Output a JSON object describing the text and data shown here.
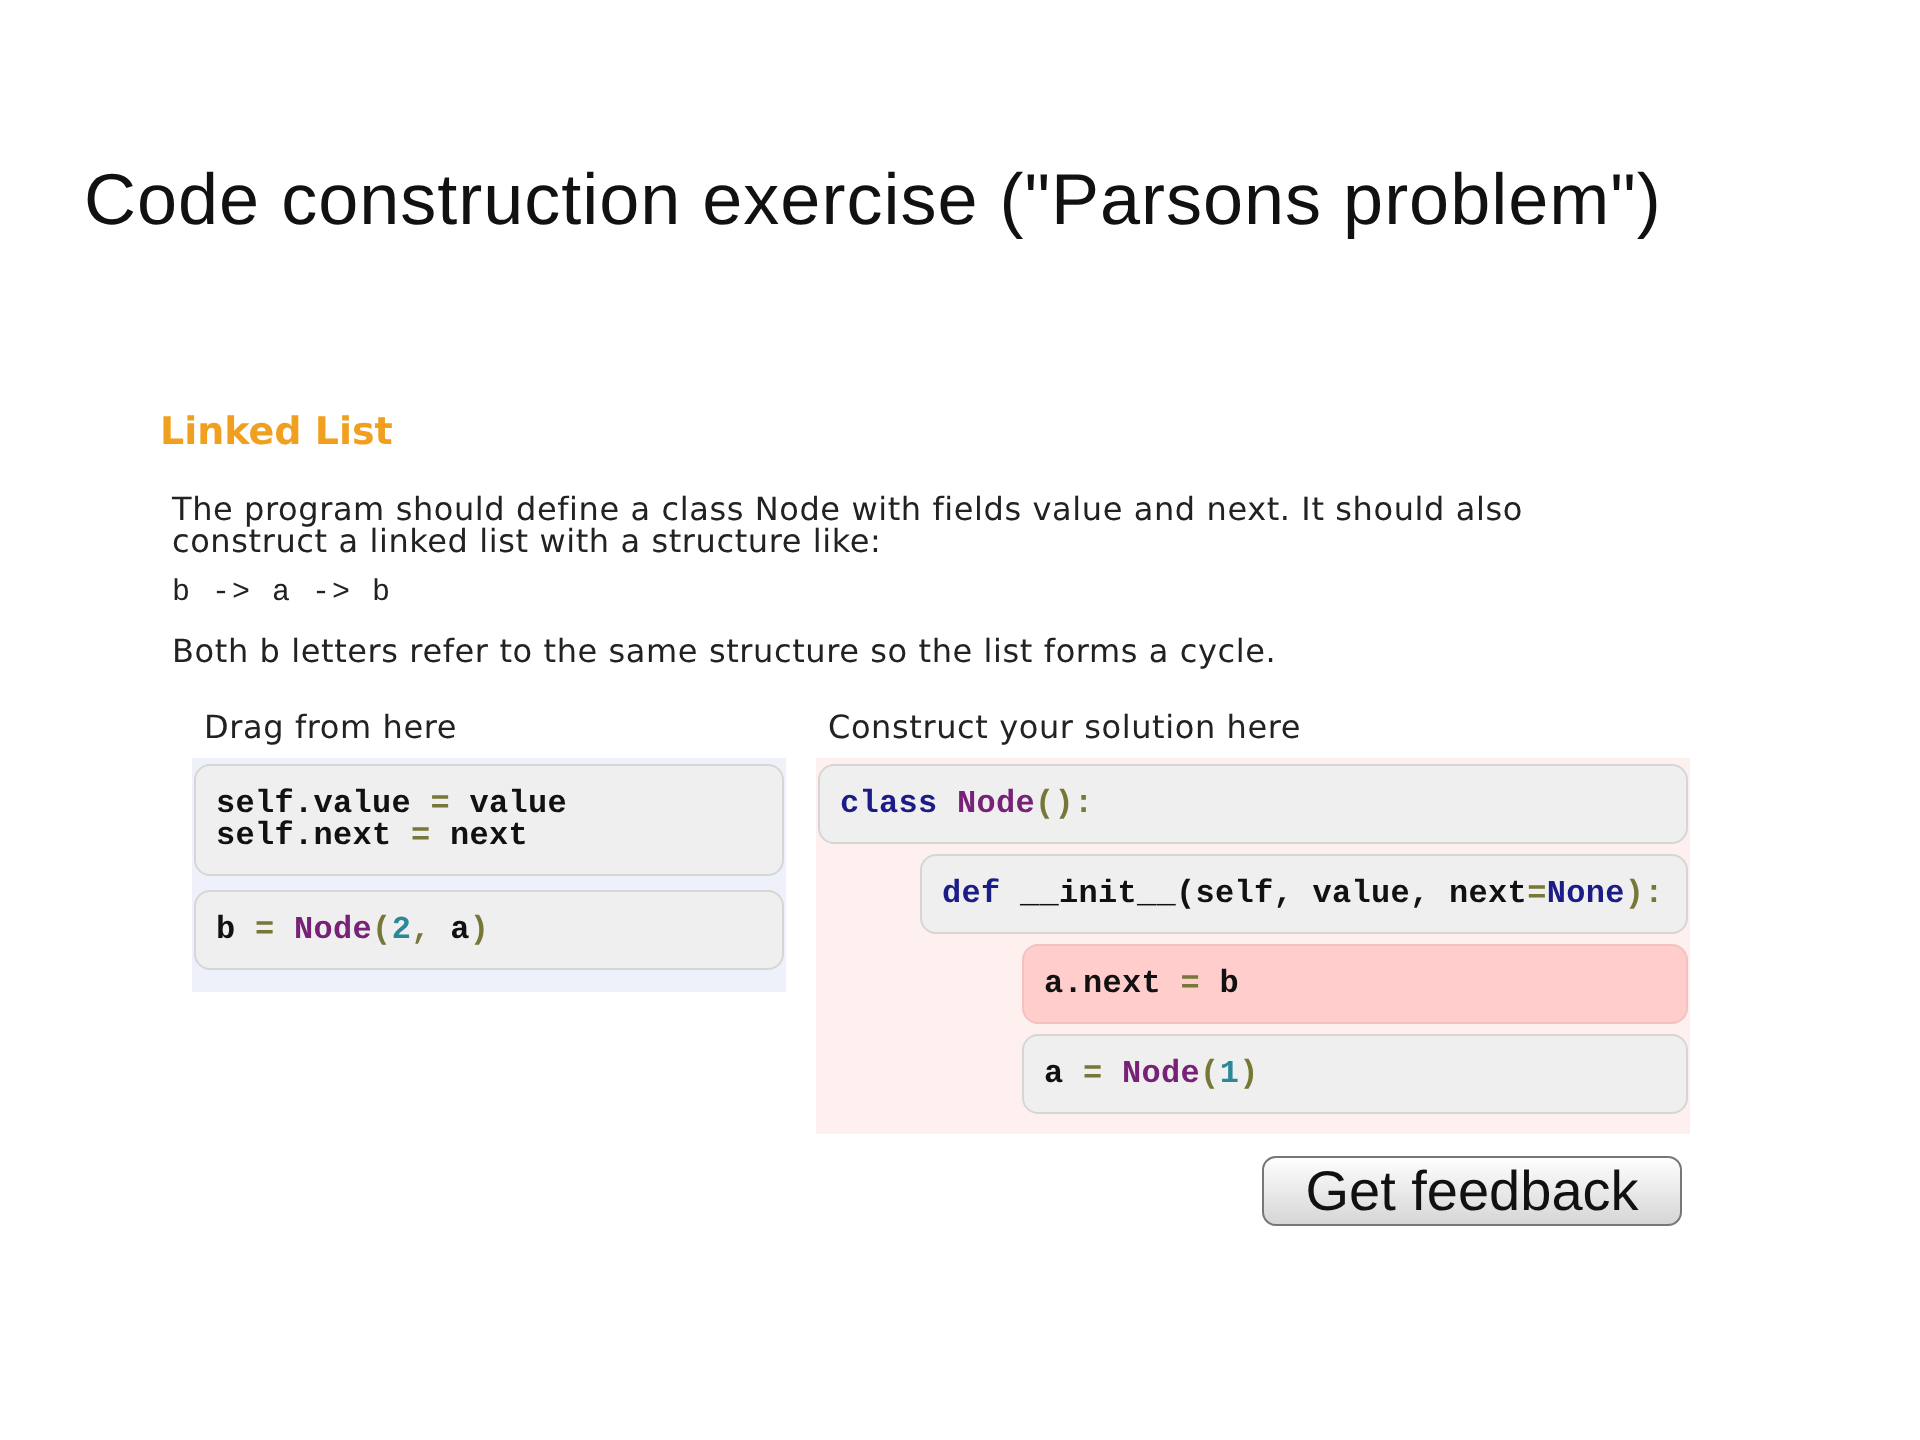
{
  "page_title": "Code construction exercise (\"Parsons problem\")",
  "exercise": {
    "title": "Linked List",
    "description": "The program should define a class Node with fields value and next. It should also construct a linked list with a structure like:",
    "example": "b -> a -> b",
    "note": "Both b letters refer to the same structure so the list forms a cycle."
  },
  "source": {
    "label": "Drag from here",
    "blocks": [
      {
        "lines": [
          [
            {
              "kind": "plain",
              "text": "self.value"
            },
            {
              "kind": "punct",
              "text": " = "
            },
            {
              "kind": "plain",
              "text": "value"
            }
          ],
          [
            {
              "kind": "plain",
              "text": "self.next"
            },
            {
              "kind": "punct",
              "text": " = "
            },
            {
              "kind": "plain",
              "text": "next"
            }
          ]
        ]
      },
      {
        "lines": [
          [
            {
              "kind": "plain",
              "text": "b"
            },
            {
              "kind": "punct",
              "text": " = "
            },
            {
              "kind": "type",
              "text": "Node"
            },
            {
              "kind": "punct",
              "text": "("
            },
            {
              "kind": "literal",
              "text": "2"
            },
            {
              "kind": "punct",
              "text": ","
            },
            {
              "kind": "plain",
              "text": " a"
            },
            {
              "kind": "punct",
              "text": ")"
            }
          ]
        ]
      }
    ]
  },
  "solution": {
    "label": "Construct your solution here",
    "incorrect": true,
    "blocks": [
      {
        "incorrect": false,
        "lines": [
          [
            {
              "kind": "keyword",
              "text": "class"
            },
            {
              "kind": "type",
              "text": " Node"
            },
            {
              "kind": "punct",
              "text": "():"
            }
          ]
        ],
        "children": [
          {
            "incorrect": false,
            "lines": [
              [
                {
                  "kind": "keyword",
                  "text": "def"
                },
                {
                  "kind": "plain",
                  "text": " __init__(self, value, next"
                },
                {
                  "kind": "punct",
                  "text": "="
                },
                {
                  "kind": "keyword",
                  "text": "None"
                },
                {
                  "kind": "punct",
                  "text": "):"
                }
              ]
            ],
            "children": [
              {
                "incorrect": true,
                "lines": [
                  [
                    {
                      "kind": "plain",
                      "text": "a.next"
                    },
                    {
                      "kind": "punct",
                      "text": " = "
                    },
                    {
                      "kind": "plain",
                      "text": "b"
                    }
                  ]
                ]
              },
              {
                "incorrect": false,
                "lines": [
                  [
                    {
                      "kind": "plain",
                      "text": "a"
                    },
                    {
                      "kind": "punct",
                      "text": " = "
                    },
                    {
                      "kind": "type",
                      "text": "Node"
                    },
                    {
                      "kind": "punct",
                      "text": "("
                    },
                    {
                      "kind": "literal",
                      "text": "1"
                    },
                    {
                      "kind": "punct",
                      "text": ")"
                    }
                  ]
                ]
              }
            ]
          }
        ]
      }
    ]
  },
  "button": "Get feedback"
}
